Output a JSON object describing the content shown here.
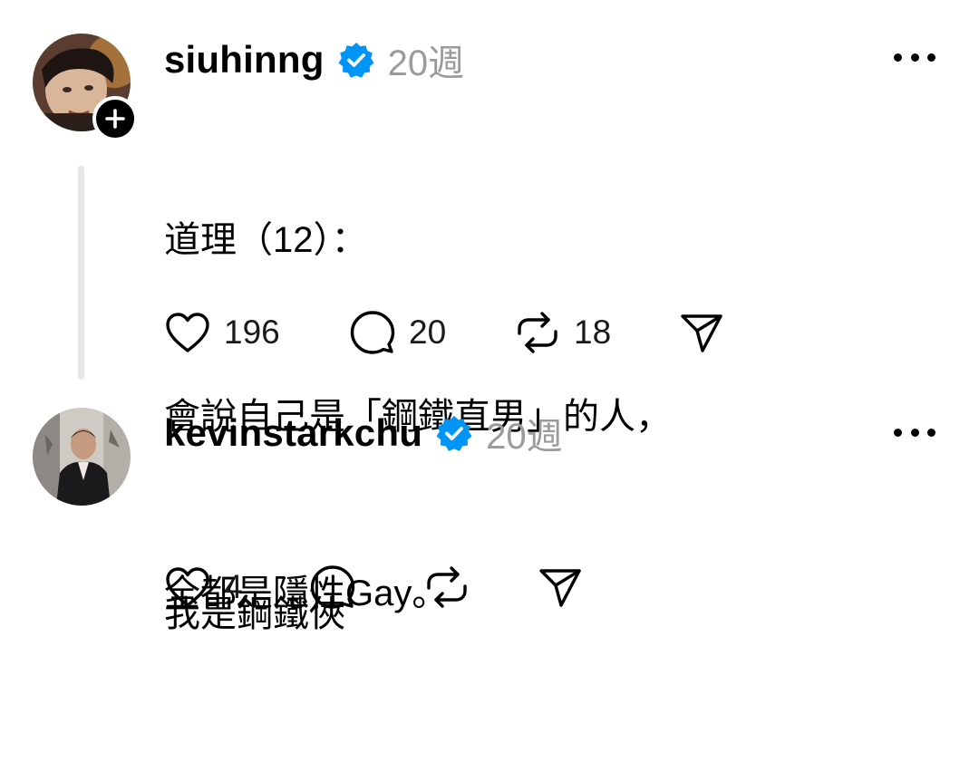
{
  "posts": [
    {
      "username": "siuhinng",
      "verified": true,
      "time": "20週",
      "lines": [
        "道理（12）：",
        "會說自己是「鋼鐵直男」的人，",
        "全都是隱性Gay。"
      ],
      "likes": "196",
      "comments": "20",
      "reposts": "18",
      "has_follow_badge": true
    },
    {
      "username": "kevinstarkchu",
      "verified": true,
      "time": "20週",
      "lines": [
        "我是鋼鐵俠"
      ],
      "likes": "4",
      "comments": "",
      "reposts": ""
    }
  ],
  "icons": {
    "verified": "verified-badge-icon",
    "like": "heart-icon",
    "comment": "comment-bubble-icon",
    "repost": "repost-icon",
    "share": "send-icon",
    "more": "more-dots-icon",
    "follow": "plus-icon"
  },
  "colors": {
    "verified_blue": "#0095f6",
    "muted_text": "#9b9b9b",
    "thread_line": "#e6e6e6"
  }
}
